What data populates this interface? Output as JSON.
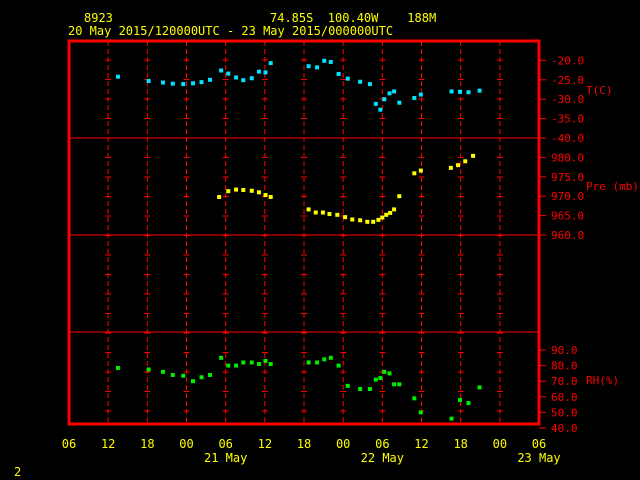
{
  "header": {
    "station": "8923",
    "position": "74.85S  100.40W    188M",
    "time_span": "20 May 2015/120000UTC - 23 May 2015/000000UTC"
  },
  "page_number": "2",
  "colors": {
    "frame": "#ff0000",
    "tick": "#ff0000",
    "label_yellow": "#ffff00",
    "temperature": "#00e5ff",
    "pressure": "#ffff00",
    "humidity": "#00ee00"
  },
  "chart_data": {
    "type": "scatter",
    "x_axis": {
      "unit": "hours from 20 May 06UTC",
      "range": [
        0,
        72
      ],
      "tick_hours": [
        0,
        6,
        12,
        18,
        24,
        30,
        36,
        42,
        48,
        54,
        60,
        66,
        72
      ],
      "tick_labels": [
        "06",
        "12",
        "18",
        "00",
        "06",
        "12",
        "18",
        "00",
        "06",
        "12",
        "18",
        "00",
        "06"
      ],
      "date_labels": [
        {
          "hour": 24,
          "label": "21 May"
        },
        {
          "hour": 48,
          "label": "22 May"
        },
        {
          "hour": 72,
          "label": "23 May"
        }
      ]
    },
    "panels": [
      {
        "id": "temperature",
        "label": "T(C)",
        "ylim": [
          -40,
          -20
        ],
        "ticks": [
          -20,
          -25,
          -30,
          -35,
          -40
        ],
        "tick_labels": [
          "-20.0",
          "-25.0",
          "-30.0",
          "-35.0",
          "-40.0"
        ],
        "x": [
          7.5,
          12.2,
          14.4,
          15.9,
          17.5,
          19.0,
          20.3,
          21.6,
          23.3,
          24.4,
          25.6,
          26.7,
          28.0,
          29.1,
          30.1,
          30.9,
          36.7,
          38.0,
          39.1,
          40.1,
          41.3,
          42.7,
          44.6,
          46.1,
          47.0,
          47.7,
          48.3,
          49.1,
          49.8,
          50.6,
          52.9,
          53.9,
          58.6,
          59.9,
          61.2,
          62.9
        ],
        "y": [
          -24.2,
          -25.3,
          -25.7,
          -26.0,
          -26.1,
          -25.9,
          -25.6,
          -25.0,
          -22.6,
          -23.4,
          -24.4,
          -25.1,
          -24.6,
          -22.9,
          -23.1,
          -20.7,
          -21.5,
          -21.8,
          -20.1,
          -20.4,
          -23.5,
          -24.7,
          -25.5,
          -26.1,
          -31.2,
          -32.7,
          -30.0,
          -28.5,
          -28.0,
          -30.9,
          -29.7,
          -28.8,
          -28.0,
          -28.1,
          -28.2,
          -27.8
        ],
        "note": "cyan markers"
      },
      {
        "id": "pressure",
        "label": "Pre (mb)",
        "ylim": [
          960,
          980
        ],
        "ticks": [
          980,
          975,
          970,
          965,
          960
        ],
        "tick_labels": [
          "980.0",
          "975.0",
          "970.0",
          "965.0",
          "960.0"
        ],
        "x": [
          23.0,
          24.4,
          25.6,
          26.7,
          28.0,
          29.1,
          30.1,
          30.9,
          36.7,
          37.8,
          38.9,
          39.9,
          41.1,
          42.3,
          43.4,
          44.6,
          45.7,
          46.6,
          47.4,
          48.0,
          48.6,
          49.2,
          49.8,
          50.6,
          52.9,
          53.9,
          58.5,
          59.6,
          60.7,
          61.9
        ],
        "y": [
          969.8,
          971.3,
          971.7,
          971.6,
          971.4,
          971.0,
          970.3,
          969.8,
          966.6,
          965.8,
          965.8,
          965.4,
          965.2,
          964.6,
          964.0,
          963.8,
          963.4,
          963.4,
          963.9,
          964.5,
          965.2,
          965.7,
          966.6,
          970.0,
          975.9,
          976.6,
          977.3,
          978.0,
          979.0,
          980.4
        ],
        "note": "yellow markers"
      },
      {
        "id": "humidity",
        "label": "RH(%)",
        "ylim": [
          40,
          90
        ],
        "ticks": [
          90,
          80,
          70,
          60,
          50,
          40
        ],
        "tick_labels": [
          "90.0",
          "80.0",
          "70.0",
          "60.0",
          "50.0",
          "40.0"
        ],
        "x": [
          7.5,
          12.2,
          14.4,
          15.9,
          17.5,
          19.0,
          20.3,
          21.6,
          23.3,
          24.4,
          25.6,
          26.7,
          28.0,
          29.1,
          30.1,
          30.9,
          36.7,
          38.0,
          39.1,
          40.1,
          41.3,
          42.7,
          44.6,
          46.1,
          47.0,
          47.7,
          48.3,
          49.1,
          49.8,
          50.6,
          52.9,
          53.9,
          58.6,
          59.9,
          61.2,
          62.9
        ],
        "y": [
          78.5,
          77.5,
          76.0,
          74.0,
          73.5,
          70.0,
          72.5,
          74.0,
          85.0,
          80.0,
          80.0,
          82.0,
          82.0,
          81.0,
          83.0,
          81.0,
          82.0,
          82.0,
          84.0,
          85.0,
          80.0,
          67.0,
          65.0,
          65.0,
          71.0,
          72.0,
          76.0,
          75.0,
          68.0,
          68.0,
          59.0,
          50.0,
          46.0,
          58.0,
          56.0,
          66.0
        ],
        "note": "green markers"
      }
    ],
    "grid": true
  }
}
